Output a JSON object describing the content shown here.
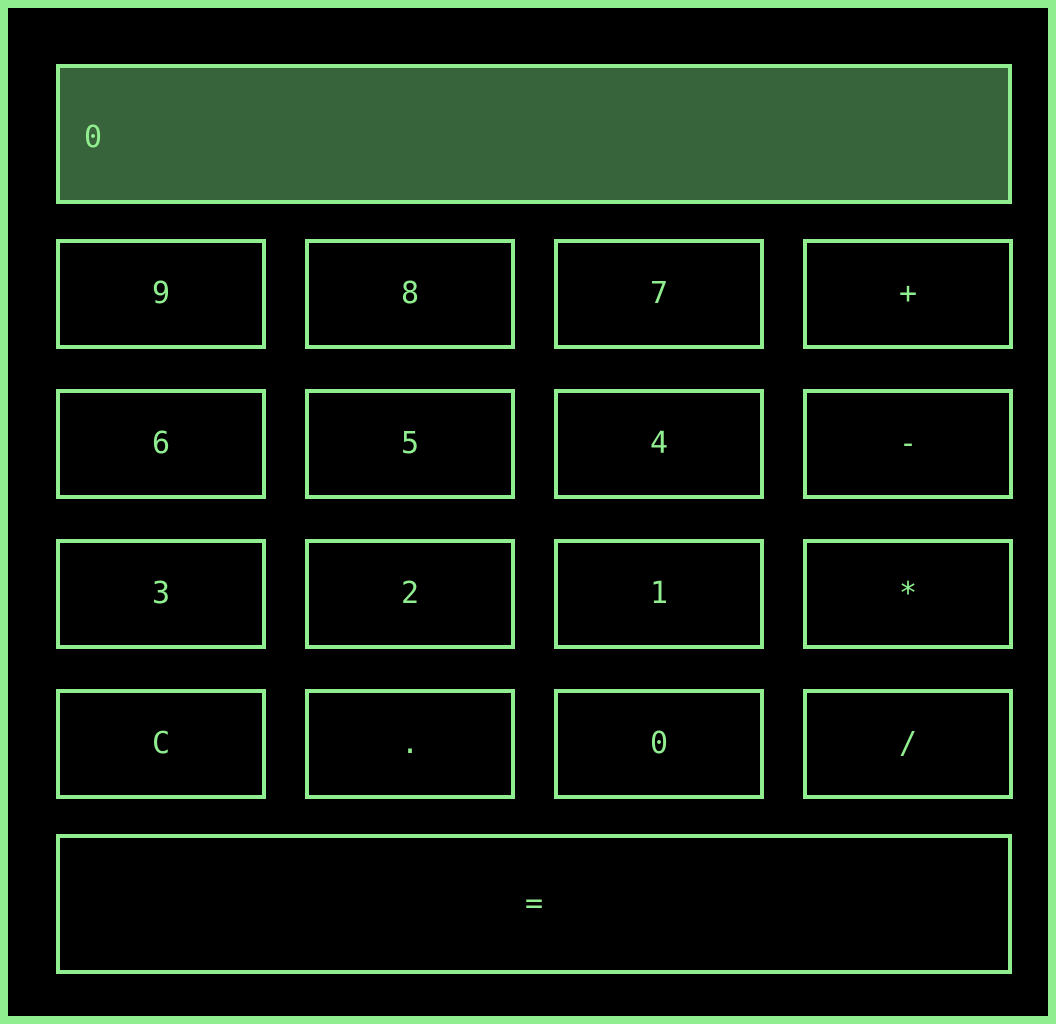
{
  "display": {
    "value": "0"
  },
  "keypad": {
    "row1": [
      "9",
      "8",
      "7",
      "+"
    ],
    "row2": [
      "6",
      "5",
      "4",
      "-"
    ],
    "row3": [
      "3",
      "2",
      "1",
      "*"
    ],
    "row4": [
      "C",
      ".",
      "0",
      "/"
    ],
    "equals": "="
  },
  "colors": {
    "accent": "#90ee90",
    "background": "#000000",
    "display_background": "#38643c"
  }
}
